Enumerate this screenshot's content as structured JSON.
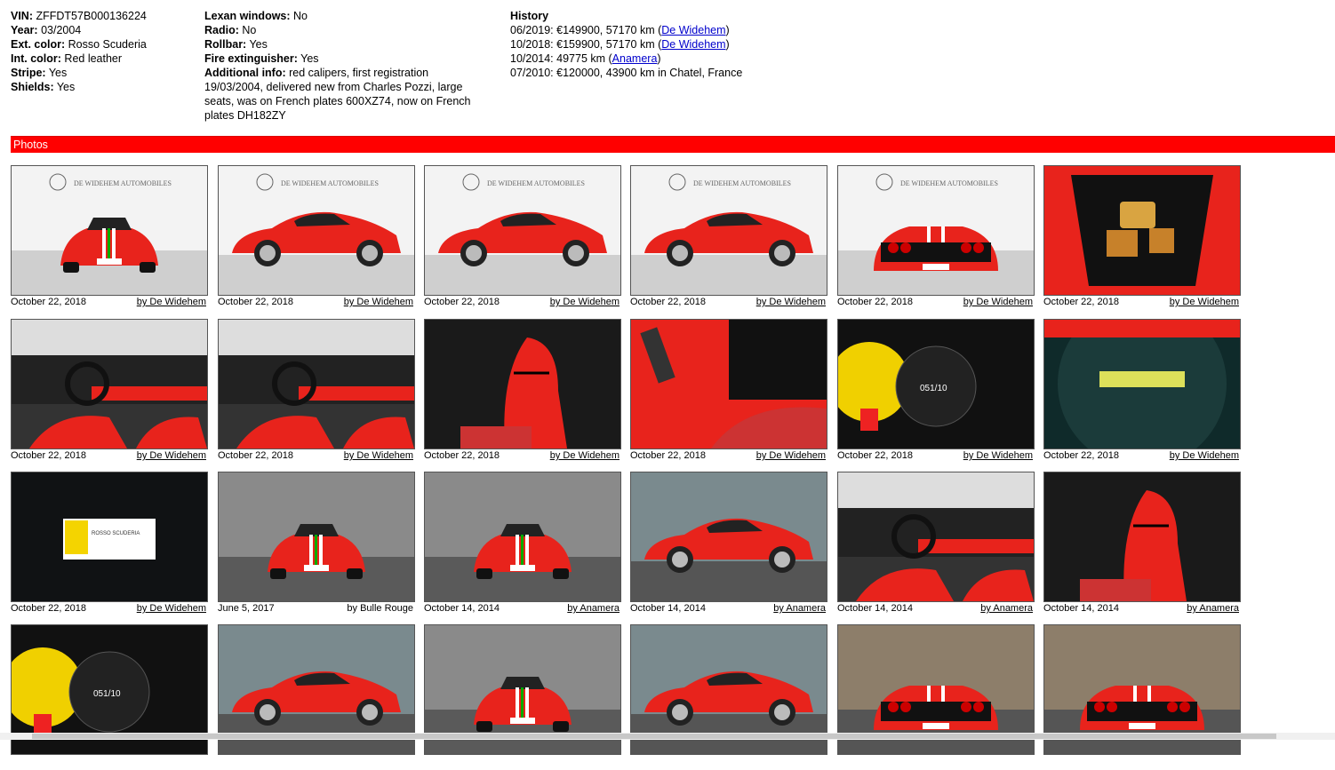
{
  "info": {
    "col1": [
      {
        "label": "VIN:",
        "value": "ZFFDT57B000136224"
      },
      {
        "label": "Year:",
        "value": "03/2004"
      },
      {
        "label": "Ext. color:",
        "value": "Rosso Scuderia"
      },
      {
        "label": "Int. color:",
        "value": "Red leather"
      },
      {
        "label": "Stripe:",
        "value": "Yes"
      },
      {
        "label": "Shields:",
        "value": "Yes"
      }
    ],
    "col2": [
      {
        "label": "Lexan windows:",
        "value": "No"
      },
      {
        "label": "Radio:",
        "value": "No"
      },
      {
        "label": "Rollbar:",
        "value": "Yes"
      },
      {
        "label": "Fire extinguisher:",
        "value": "Yes"
      },
      {
        "label": "Additional info:",
        "value": "red calipers, first registration 19/03/2004, delivered new from Charles Pozzi, large seats, was on French plates 600XZ74, now on French plates DH182ZY"
      }
    ]
  },
  "history": {
    "title": "History",
    "rows": [
      {
        "text": "06/2019: €149900, 57170 km (",
        "link": "De Widehem",
        "after": ")"
      },
      {
        "text": "10/2018: €159900, 57170 km (",
        "link": "De Widehem",
        "after": ")"
      },
      {
        "text": "10/2014: 49775 km (",
        "link": "Anamera",
        "after": ")"
      },
      {
        "text": "07/2010: €120000, 43900 km in Chatel, France",
        "link": "",
        "after": ""
      }
    ]
  },
  "photos_label": "Photos",
  "colors": {
    "bar": "#ff0000",
    "ferrari_red": "#e8231c",
    "link": "#0000cc"
  },
  "photos": [
    {
      "date": "October 22, 2018",
      "by": "by De Widehem",
      "link": true,
      "kind": "front-studio"
    },
    {
      "date": "October 22, 2018",
      "by": "by De Widehem",
      "link": true,
      "kind": "three-quarter-studio"
    },
    {
      "date": "October 22, 2018",
      "by": "by De Widehem",
      "link": true,
      "kind": "side-studio"
    },
    {
      "date": "October 22, 2018",
      "by": "by De Widehem",
      "link": true,
      "kind": "rear-three-quarter-studio"
    },
    {
      "date": "October 22, 2018",
      "by": "by De Widehem",
      "link": true,
      "kind": "rear-studio"
    },
    {
      "date": "October 22, 2018",
      "by": "by De Widehem",
      "link": true,
      "kind": "trunk"
    },
    {
      "date": "October 22, 2018",
      "by": "by De Widehem",
      "link": true,
      "kind": "dashboard"
    },
    {
      "date": "October 22, 2018",
      "by": "by De Widehem",
      "link": true,
      "kind": "dashboard"
    },
    {
      "date": "October 22, 2018",
      "by": "by De Widehem",
      "link": true,
      "kind": "seats"
    },
    {
      "date": "October 22, 2018",
      "by": "by De Widehem",
      "link": true,
      "kind": "console"
    },
    {
      "date": "October 22, 2018",
      "by": "by De Widehem",
      "link": true,
      "kind": "gauges"
    },
    {
      "date": "October 22, 2018",
      "by": "by De Widehem",
      "link": true,
      "kind": "plaque"
    },
    {
      "date": "October 22, 2018",
      "by": "by De Widehem",
      "link": true,
      "kind": "badge"
    },
    {
      "date": "June 5, 2017",
      "by": "by Bulle Rouge",
      "link": false,
      "kind": "street-front"
    },
    {
      "date": "October 14, 2014",
      "by": "by Anamera",
      "link": true,
      "kind": "street-front"
    },
    {
      "date": "October 14, 2014",
      "by": "by Anamera",
      "link": true,
      "kind": "street-side"
    },
    {
      "date": "October 14, 2014",
      "by": "by Anamera",
      "link": true,
      "kind": "dashboard"
    },
    {
      "date": "October 14, 2014",
      "by": "by Anamera",
      "link": true,
      "kind": "seats"
    },
    {
      "date": "",
      "by": "",
      "link": false,
      "kind": "gauges"
    },
    {
      "date": "",
      "by": "",
      "link": false,
      "kind": "street-side"
    },
    {
      "date": "",
      "by": "",
      "link": false,
      "kind": "street-front"
    },
    {
      "date": "",
      "by": "",
      "link": false,
      "kind": "street-side"
    },
    {
      "date": "",
      "by": "",
      "link": false,
      "kind": "street-rear"
    },
    {
      "date": "",
      "by": "",
      "link": false,
      "kind": "street-rear"
    }
  ]
}
